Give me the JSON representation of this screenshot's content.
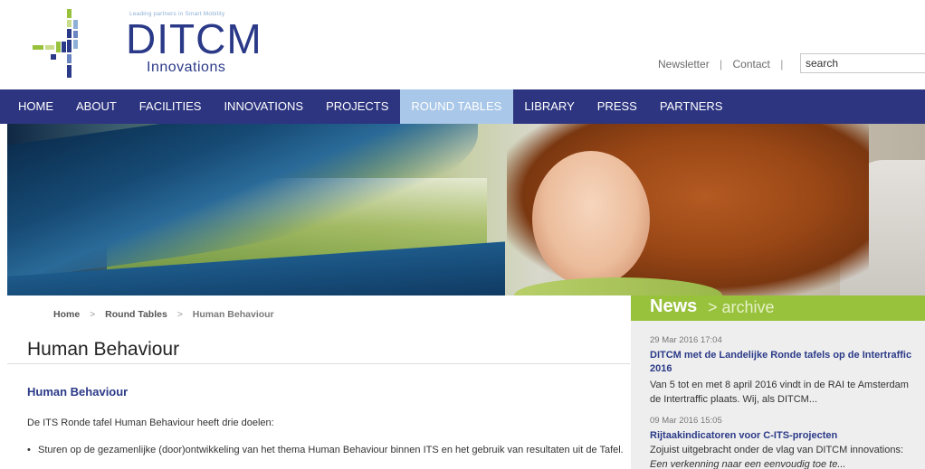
{
  "logo": {
    "tagline": "Leading partners in Smart Mobility",
    "wordmark": "DITCM",
    "subtitle": "Innovations"
  },
  "top_links": {
    "newsletter": "Newsletter",
    "separator": "|",
    "contact": "Contact"
  },
  "search": {
    "value": "search"
  },
  "nav": {
    "items": [
      {
        "label": "HOME"
      },
      {
        "label": "ABOUT"
      },
      {
        "label": "FACILITIES"
      },
      {
        "label": "INNOVATIONS"
      },
      {
        "label": "PROJECTS"
      },
      {
        "label": "ROUND TABLES"
      },
      {
        "label": "LIBRARY"
      },
      {
        "label": "PRESS"
      },
      {
        "label": "PARTNERS"
      }
    ],
    "active_index": 5
  },
  "breadcrumb": {
    "items": [
      "Home",
      "Round Tables",
      "Human Behaviour"
    ],
    "separator": ">"
  },
  "main": {
    "title": "Human Behaviour",
    "section_heading": "Human Behaviour",
    "intro": "De ITS Ronde tafel Human Behaviour heeft drie doelen:",
    "goals": [
      "Sturen op de gezamenlijke (door)ontwikkeling van het thema Human Behaviour binnen ITS en het gebruik van resultaten uit de Tafel."
    ]
  },
  "news": {
    "title": "News",
    "archive_label": "> archive",
    "items": [
      {
        "date": "29 Mar 2016 17:04",
        "title": "DITCM met de Landelijke Ronde tafels op de Intertraffic 2016",
        "excerpt": "Van 5 tot en met 8 april 2016 vindt in de RAI te Amsterdam de Intertraffic plaats. Wij, als DITCM..."
      },
      {
        "date": "09 Mar 2016 15:05",
        "title": "Rijtaakindicatoren voor C-ITS-projecten",
        "excerpt": "Zojuist uitgebracht onder de vlag van DITCM innovations:",
        "excerpt_italic": "Een verkenning naar een eenvoudig toe te..."
      }
    ]
  },
  "colors": {
    "nav_bg": "#2d3580",
    "nav_active": "#a9c7e8",
    "brand_blue": "#2b3a88",
    "news_green": "#98c13c",
    "news_panel": "#eeeeee"
  }
}
